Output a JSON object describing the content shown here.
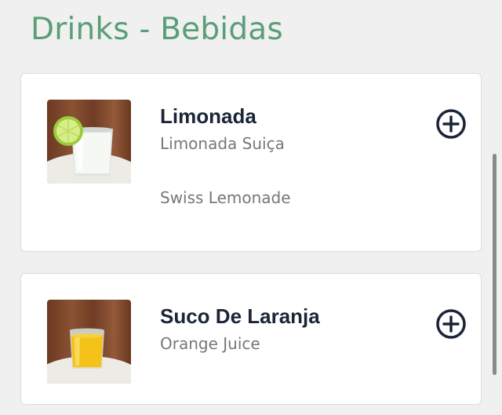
{
  "section": {
    "title": "Drinks - Bebidas"
  },
  "items": [
    {
      "name": "Limonada",
      "subtitle": "Limonada Suiça",
      "description": "Swiss Lemonade",
      "image_icon": "lemonade-glass-image",
      "add_icon": "plus-circle-icon"
    },
    {
      "name": "Suco De Laranja",
      "subtitle": "Orange Juice",
      "image_icon": "orange-juice-glass-image",
      "add_icon": "plus-circle-icon"
    }
  ],
  "colors": {
    "accent_title": "#5a9e78",
    "item_name": "#1b2536",
    "secondary_text": "#777777",
    "add_icon": "#1b2536",
    "background": "#f0f0f0",
    "card": "#ffffff"
  }
}
